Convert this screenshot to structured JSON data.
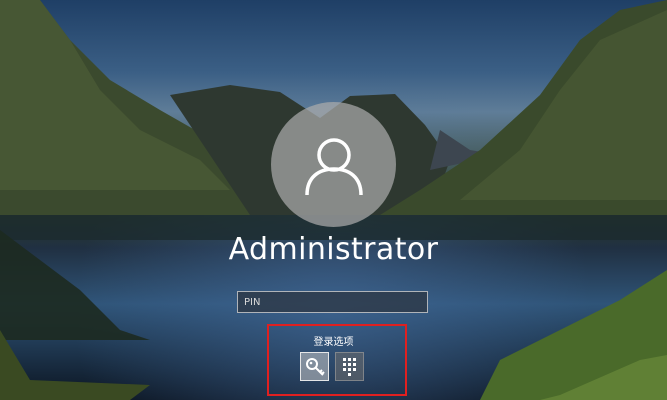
{
  "user": {
    "name": "Administrator",
    "avatar_icon": "user-icon"
  },
  "pin_field": {
    "placeholder": "PIN",
    "value": ""
  },
  "sign_in_options": {
    "label": "登录选项",
    "options": [
      {
        "name": "security-key",
        "icon": "key-icon"
      },
      {
        "name": "pin",
        "icon": "pin-keypad-icon"
      }
    ]
  },
  "colors": {
    "highlight_box": "#e02020",
    "text": "#ffffff"
  }
}
